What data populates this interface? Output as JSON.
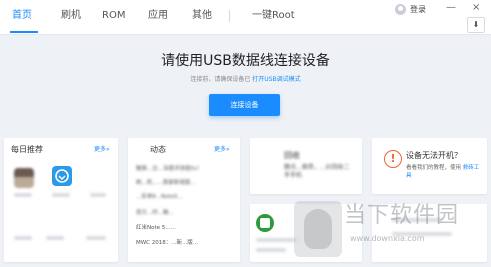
{
  "nav": {
    "tabs": [
      {
        "label": "首页"
      },
      {
        "label": "刷机"
      },
      {
        "label": "ROM"
      },
      {
        "label": "应用"
      },
      {
        "label": "其他"
      },
      {
        "label": "一键Root"
      }
    ],
    "active_tab": 0
  },
  "window": {
    "login_label": "登录",
    "minimize_glyph": "—",
    "close_glyph": "×",
    "download_icon": "download-icon"
  },
  "hero": {
    "title": "请使用USB数据线连接设备",
    "subtitle_prefix": "连接前，请确保设备已",
    "subtitle_link": "打开USB调试模式",
    "connect_button": "连接设备"
  },
  "daily": {
    "title": "每日推荐",
    "more": "更多»"
  },
  "news": {
    "title": "动态",
    "more": "更多»",
    "items": [
      "魅族...交...深度评测造5s！",
      "刷...机......首家新增版...",
      "...安卓8...Note5...",
      "官方...时...魅...",
      "红米Note 5......",
      "MWC 2018：...新...版..."
    ]
  },
  "recycle": {
    "title": "回收",
    "desc_line1": "腾讯...推荐，...价回收二",
    "desc_line2": "手手机"
  },
  "help": {
    "title": "设备无法开机？",
    "desc_prefix": "看看我们的教程，使用",
    "desc_link": "救砖工具"
  },
  "watermark": {
    "title": "当下软件园",
    "url": "www.downxia.com"
  },
  "colors": {
    "accent": "#1a8cff",
    "warning": "#f0652f",
    "background": "#eef1f5"
  }
}
